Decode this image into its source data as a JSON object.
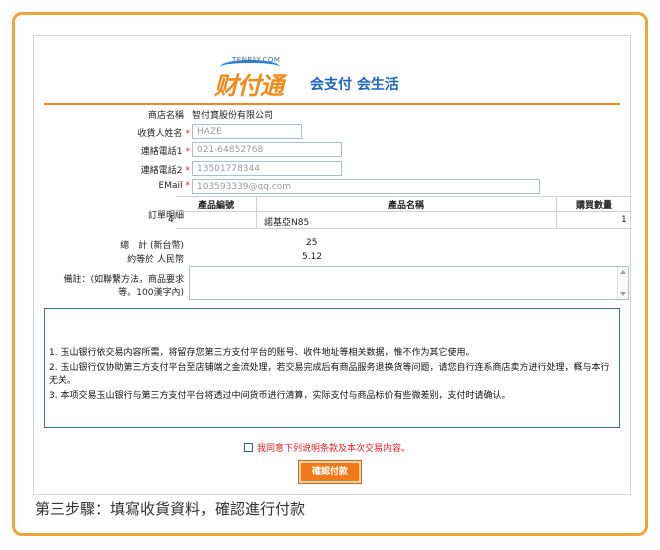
{
  "logo": {
    "brand_small": "TENPAY.COM",
    "brand_cn": "财付通",
    "slogan": "会支付 会生活"
  },
  "form": {
    "store_label": "商店名稱",
    "store_value": "智付寶股份有限公司",
    "name_label": "收貨人姓名",
    "name_placeholder": "HAZE",
    "phone1_label": "連絡電話1",
    "phone1_placeholder": "021-64852768",
    "phone2_label": "連絡電話2",
    "phone2_placeholder": "13501778344",
    "email_label": "EMail",
    "email_placeholder": "103593339@qq.com",
    "required_mark": "*"
  },
  "order": {
    "label": "訂單明細",
    "headers": [
      "產品編號",
      "產品名稱",
      "購買數量"
    ],
    "rows": [
      [
        "4",
        "諾基亞N85",
        "1"
      ]
    ]
  },
  "totals": {
    "total_label": "總　計 (新台幣)",
    "total_value": "25",
    "approx_label": "約等於 人民幣",
    "approx_value": "5.12"
  },
  "memo": {
    "label_line1": "備註：(如聯繫方法，商品要求",
    "label_line2": "等。100漢字內)"
  },
  "notice": {
    "items": [
      "1.  玉山银行依交易内容所需，将留存您第三方支付平台的账号、收件地址等相关数据，惟不作为其它使用。",
      "2.  玉山银行仅协助第三方支付平台至店铺端之金流处理，若交易完成后有商品服务退换货等问题，请您自行连系商店卖方进行处理，概与本行无关。",
      "3.  本项交易玉山银行与第三方支付平台将透过中间货币进行清算，实际支付与商品标价有些微差别，支付时请确认。"
    ]
  },
  "agree_text": "我同意下列说明条款及本次交易内容。",
  "confirm_button": "確認付款",
  "caption": "第三步驟：填寫收貨資料，確認進行付款",
  "colors": {
    "frame": "#f2a33a",
    "button": "#f07a1a",
    "required": "#e02020",
    "brand_blue": "#1d66c0"
  }
}
